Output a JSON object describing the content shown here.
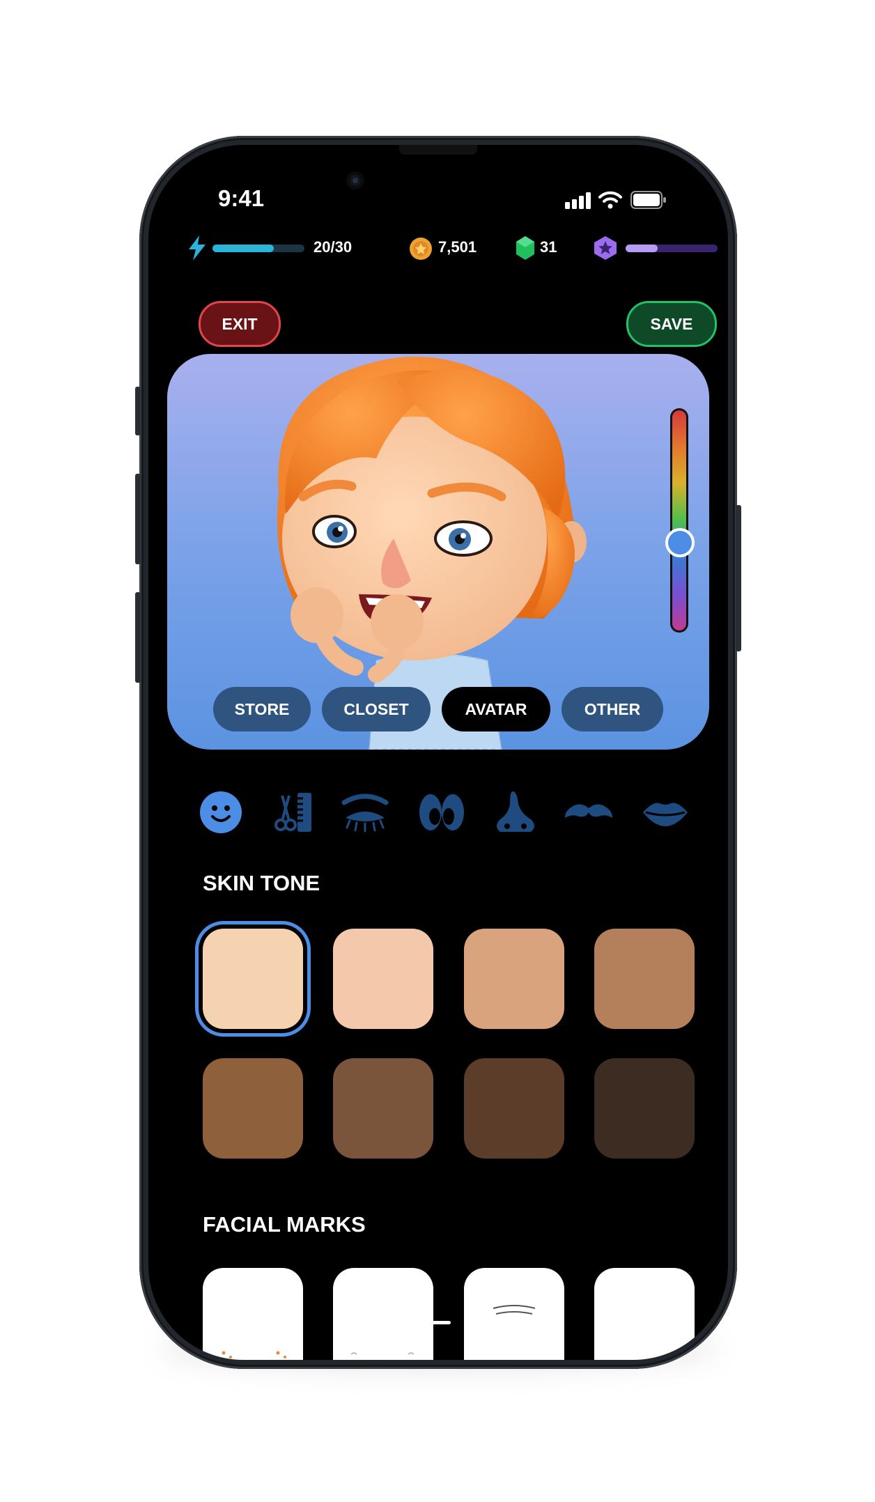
{
  "status_bar": {
    "time": "9:41"
  },
  "hud": {
    "energy": {
      "text": "20/30",
      "value": 20,
      "max": 30,
      "color": "#2bb3d8",
      "icon": "lightning-icon"
    },
    "coins": {
      "text": "7,501",
      "icon": "coin-icon",
      "color": "#f0a22e"
    },
    "gems": {
      "text": "31",
      "icon": "gem-icon",
      "color": "#1fbf5e"
    },
    "level": {
      "progress": 0.35,
      "icon": "star-badge-icon",
      "color": "#9b6cf0"
    }
  },
  "header": {
    "exit_label": "EXIT",
    "save_label": "SAVE"
  },
  "preview": {
    "color_slider_value": 0.6
  },
  "tabs": [
    {
      "label": "STORE",
      "active": false
    },
    {
      "label": "CLOSET",
      "active": false
    },
    {
      "label": "AVATAR",
      "active": true
    },
    {
      "label": "OTHER",
      "active": false
    }
  ],
  "categories": [
    {
      "icon": "face-icon",
      "selected": true
    },
    {
      "icon": "hair-tools-icon",
      "selected": false
    },
    {
      "icon": "eyebrow-icon",
      "selected": false
    },
    {
      "icon": "eyes-icon",
      "selected": false
    },
    {
      "icon": "nose-icon",
      "selected": false
    },
    {
      "icon": "mustache-icon",
      "selected": false
    },
    {
      "icon": "lips-icon",
      "selected": false
    }
  ],
  "skin_tone": {
    "title": "SKIN TONE",
    "selected_index": 0,
    "swatches": [
      "#f5d2b0",
      "#f4c8aa",
      "#d8a37d",
      "#b4805c",
      "#8e613c",
      "#7a553b",
      "#5c3d2a",
      "#3d2c22"
    ]
  },
  "facial_marks": {
    "title": "FACIAL MARKS"
  },
  "colors": {
    "accent": "#4c8ee6",
    "exit": "#e0464b",
    "save": "#1ec466",
    "tab_inactive": "#2f5480",
    "icon": "#1f4c80"
  }
}
